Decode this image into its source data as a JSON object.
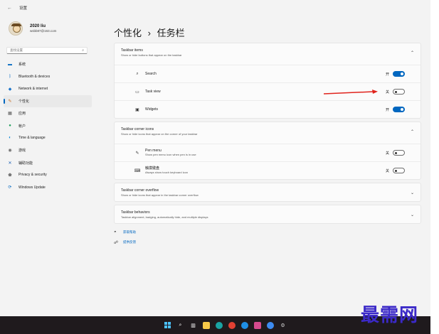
{
  "window": {
    "title": "设置"
  },
  "profile": {
    "name": "2020 liu",
    "email": "wsbb87@163.com"
  },
  "search": {
    "placeholder": "查找设置"
  },
  "nav": [
    {
      "label": "系统",
      "icon": "monitor-icon",
      "color": "#0067c0"
    },
    {
      "label": "Bluetooth & devices",
      "icon": "bluetooth-icon",
      "color": "#0067c0"
    },
    {
      "label": "Network & internet",
      "icon": "wifi-icon",
      "color": "#1a73c9"
    },
    {
      "label": "个性化",
      "icon": "brush-icon",
      "color": "#c56a1a",
      "active": true
    },
    {
      "label": "应用",
      "icon": "apps-icon",
      "color": "#555555"
    },
    {
      "label": "帐户",
      "icon": "person-icon",
      "color": "#1e9e5a"
    },
    {
      "label": "Time & language",
      "icon": "globe-clock-icon",
      "color": "#0f8ad8"
    },
    {
      "label": "游戏",
      "icon": "gamepad-icon",
      "color": "#666666"
    },
    {
      "label": "辅助功能",
      "icon": "accessibility-icon",
      "color": "#1a5fb4"
    },
    {
      "label": "Privacy & security",
      "icon": "shield-icon",
      "color": "#777777"
    },
    {
      "label": "Windows Update",
      "icon": "update-icon",
      "color": "#0067c0"
    }
  ],
  "breadcrumb": {
    "parent": "个性化",
    "separator": "›",
    "current": "任务栏"
  },
  "taskbar_items": {
    "title": "Taskbar items",
    "desc": "Show or hide buttons that appear on the taskbar",
    "rows": [
      {
        "label": "Search",
        "icon": "search-icon",
        "glyph": "⌕",
        "state": "开",
        "on": true
      },
      {
        "label": "Task view",
        "icon": "task-view-icon",
        "glyph": "▭",
        "state": "关",
        "on": false
      },
      {
        "label": "Widgets",
        "icon": "widgets-icon",
        "glyph": "▣",
        "state": "开",
        "on": true
      }
    ]
  },
  "corner_icons": {
    "title": "Taskbar corner icons",
    "desc": "Show or hide icons that appear on the corner of your taskbar",
    "rows": [
      {
        "label": "Pen menu",
        "desc": "Show pen menu icon when pen is in use",
        "icon": "pen-icon",
        "glyph": "✎",
        "state": "关",
        "on": false
      },
      {
        "label": "触摸键盘",
        "desc": "Always show touch keyboard icon",
        "icon": "keyboard-icon",
        "glyph": "⌨",
        "state": "关",
        "on": false
      }
    ]
  },
  "corner_overflow": {
    "title": "Taskbar corner overflow",
    "desc": "Show or hide icons that appear in the taskbar corner overflow"
  },
  "behaviors": {
    "title": "Taskbar behaviors",
    "desc": "Taskbar alignment, badging, automatically hide, and multiple displays"
  },
  "links": {
    "help": "获取帮助",
    "feedback": "提供反馈"
  },
  "watermark": "最需网",
  "colors": {
    "accent": "#0067c0",
    "arrow": "#e0231c",
    "taskbar": "#1f1a1d",
    "watermark": "#3b29c8"
  }
}
